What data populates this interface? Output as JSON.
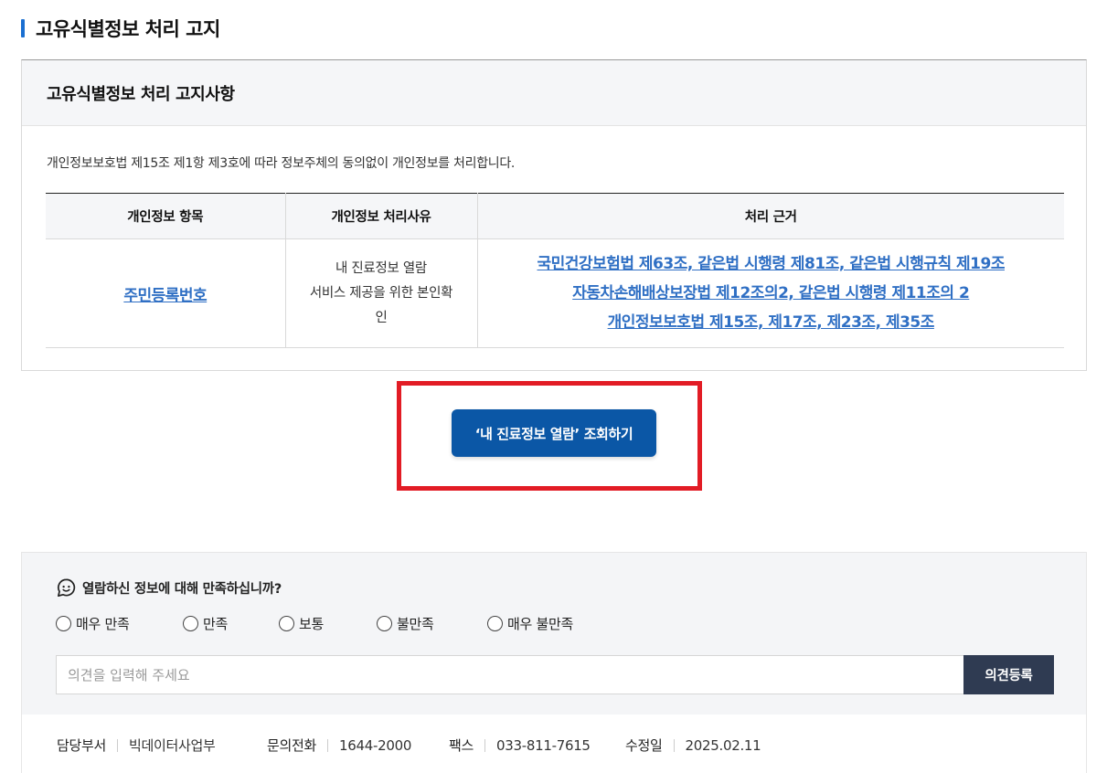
{
  "page": {
    "title": "고유식별정보 처리 고지"
  },
  "notice": {
    "heading": "고유식별정보 처리 고지사항",
    "description": "개인정보보호법 제15조 제1항 제3호에 따라 정보주체의 동의없이 개인정보를 처리합니다.",
    "table": {
      "headers": [
        "개인정보 항목",
        "개인정보 처리사유",
        "처리 근거"
      ],
      "row": {
        "item": "주민등록번호",
        "reason_lines": [
          "내 진료정보 열람",
          "서비스 제공을 위한 본인확",
          "인"
        ],
        "basis_links": [
          "국민건강보험법 제63조, 같은법 시행령 제81조, 같은법 시행규칙 제19조",
          "자동차손해배상보장법 제12조의2, 같은법 시행령 제11조의 2",
          "개인정보보호법 제15조, 제17조, 제23조, 제35조"
        ]
      }
    }
  },
  "action": {
    "query_button": "‘내 진료정보 열람’ 조회하기",
    "highlight_color": "#e21c25",
    "button_color": "#0b57a6"
  },
  "survey": {
    "question": "열람하신 정보에 대해 만족하십니까?",
    "options": [
      "매우 만족",
      "만족",
      "보통",
      "불만족",
      "매우 불만족"
    ],
    "opinion_placeholder": "의견을 입력해 주세요",
    "submit_label": "의견등록"
  },
  "footer": {
    "items": [
      {
        "key": "담당부서",
        "value": "빅데이터사업부"
      },
      {
        "key": "문의전화",
        "value": "1644-2000"
      },
      {
        "key": "팩스",
        "value": "033-811-7615"
      },
      {
        "key": "수정일",
        "value": "2025.02.11"
      }
    ]
  }
}
